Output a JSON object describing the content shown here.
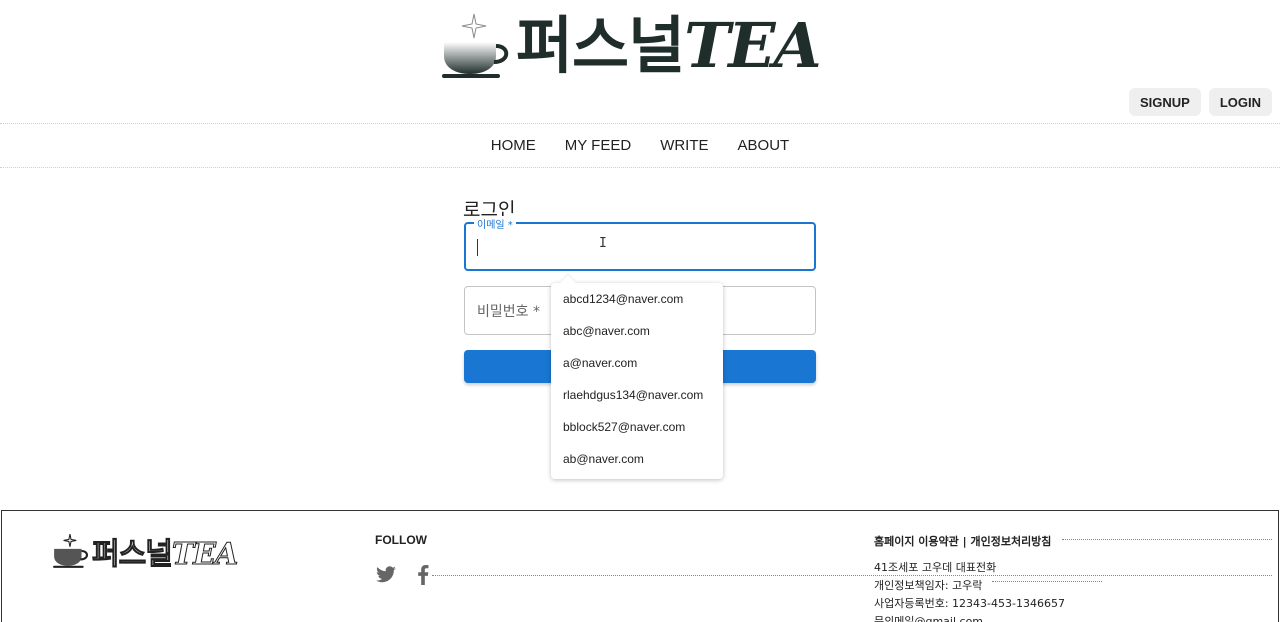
{
  "brand": {
    "name_korean": "퍼스널",
    "name_latin": "TEA"
  },
  "auth": {
    "signup_label": "SIGNUP",
    "login_label": "LOGIN"
  },
  "nav": {
    "items": [
      "HOME",
      "MY FEED",
      "WRITE",
      "ABOUT"
    ]
  },
  "login_form": {
    "title": "로그인",
    "email_label": "이메일 *",
    "email_value": "",
    "password_placeholder": "비밀번호 *",
    "submit_color": "#1976d2"
  },
  "autocomplete": {
    "options": [
      "abcd1234@naver.com",
      "abc@naver.com",
      "a@naver.com",
      "rlaehdgus134@naver.com",
      "bblock527@naver.com",
      "ab@naver.com"
    ]
  },
  "footer": {
    "follow_label": "FOLLOW",
    "social_icons": [
      "twitter-icon",
      "facebook-icon"
    ],
    "links": "홈페이지 이용약관 | 개인정보처리방침",
    "info": [
      "41조세포 고우데 대표전화",
      "개인정보책임자: 고우락",
      "사업자등록번호: 12343-453-1346657",
      "문의메일@gmail.com"
    ]
  },
  "colors": {
    "accent": "#1976d2",
    "logo_dark": "#1f2e2b"
  }
}
